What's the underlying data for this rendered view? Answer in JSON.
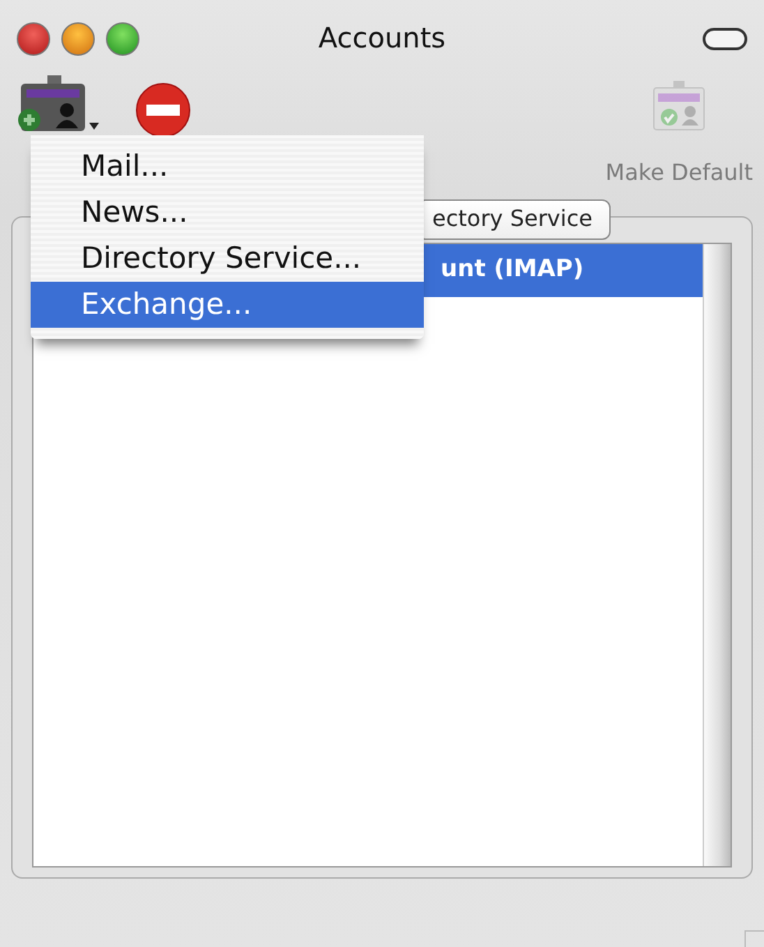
{
  "window": {
    "title": "Accounts"
  },
  "toolbar": [
    {
      "kind": "add",
      "has_menu": true
    },
    {
      "kind": "remove"
    },
    {
      "kind": "make_default",
      "label": "Make Default",
      "disabled": true
    }
  ],
  "tabs": [
    {
      "label": "ectory Service",
      "selected": false
    }
  ],
  "accounts_list": {
    "rows": [
      {
        "label": "unt (IMAP)",
        "selected": true
      }
    ]
  },
  "menu": {
    "items": [
      {
        "label": "Mail...",
        "selected": false
      },
      {
        "label": "News...",
        "selected": false
      },
      {
        "label": "Directory Service...",
        "selected": false
      },
      {
        "label": "Exchange...",
        "selected": true
      }
    ]
  }
}
